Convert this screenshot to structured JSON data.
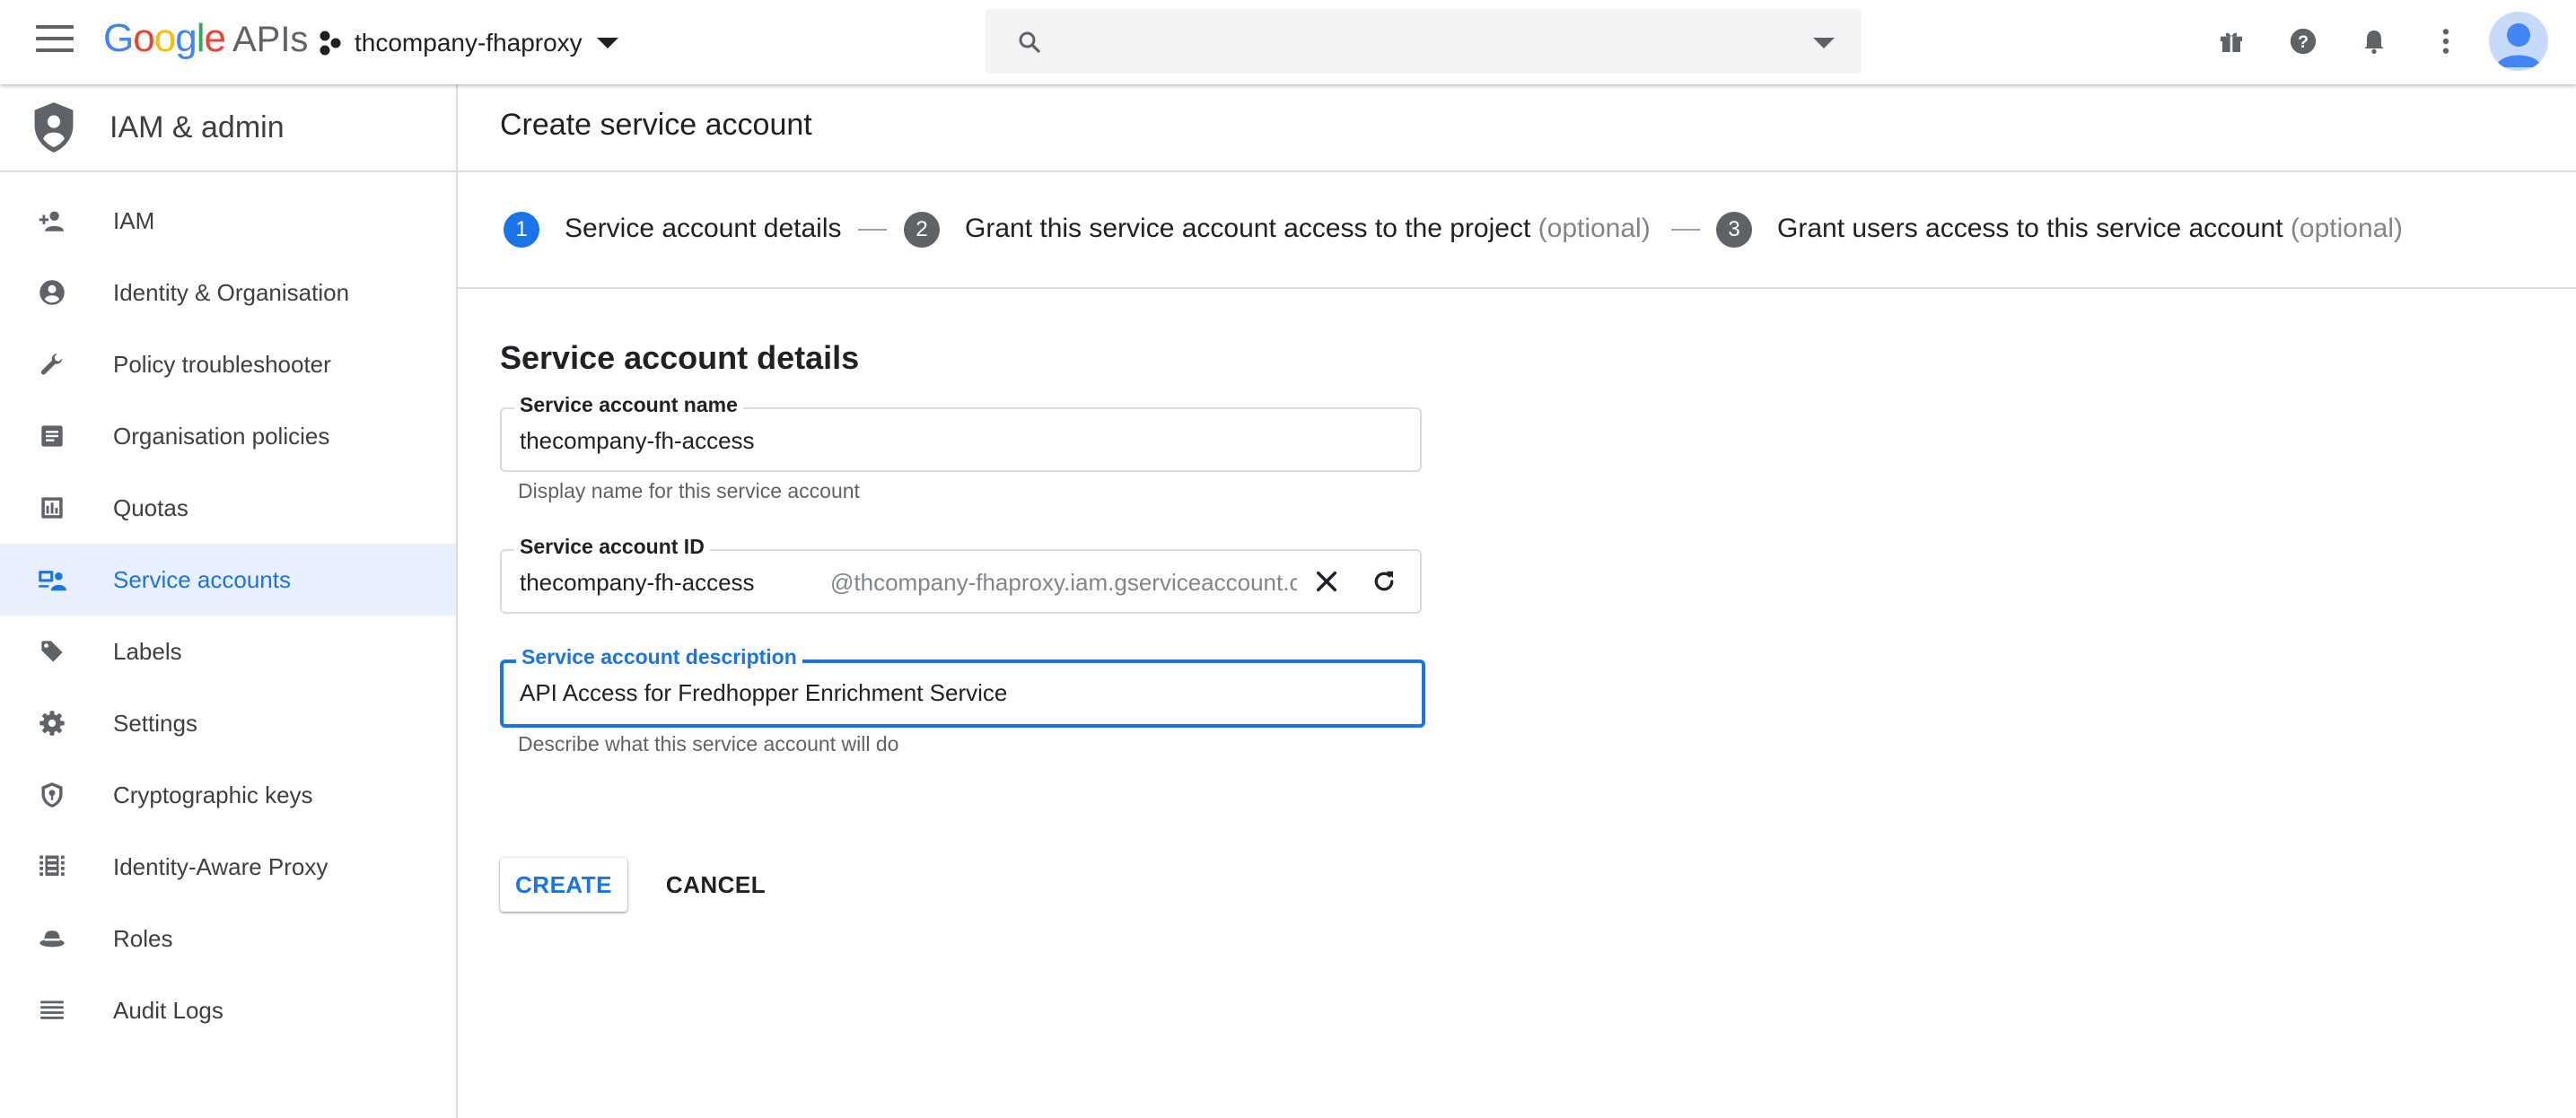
{
  "header": {
    "logo_letters": [
      "G",
      "o",
      "o",
      "g",
      "l",
      "e"
    ],
    "logo_suffix": "APIs",
    "project_name": "thcompany-fhaproxy",
    "search": {
      "value": "",
      "placeholder": ""
    },
    "icons": [
      "menu-icon",
      "project-icon",
      "search-icon",
      "gift-icon",
      "help-icon",
      "notifications-icon",
      "more-vert-icon",
      "account-avatar"
    ],
    "colors": {
      "google_blue": "#4285f4",
      "google_red": "#ea4335",
      "google_yellow": "#fbbc05",
      "google_green": "#34a853"
    }
  },
  "sidebar": {
    "title": "IAM & admin",
    "items": [
      {
        "label": "IAM",
        "icon": "person-add-icon",
        "active": false
      },
      {
        "label": "Identity & Organisation",
        "icon": "account-circle-icon",
        "active": false
      },
      {
        "label": "Policy troubleshooter",
        "icon": "wrench-icon",
        "active": false
      },
      {
        "label": "Organisation policies",
        "icon": "document-icon",
        "active": false
      },
      {
        "label": "Quotas",
        "icon": "quota-icon",
        "active": false
      },
      {
        "label": "Service accounts",
        "icon": "service-account-icon",
        "active": true
      },
      {
        "label": "Labels",
        "icon": "tag-icon",
        "active": false
      },
      {
        "label": "Settings",
        "icon": "gear-icon",
        "active": false
      },
      {
        "label": "Cryptographic keys",
        "icon": "key-shield-icon",
        "active": false
      },
      {
        "label": "Identity-Aware Proxy",
        "icon": "proxy-icon",
        "active": false
      },
      {
        "label": "Roles",
        "icon": "hat-icon",
        "active": false
      },
      {
        "label": "Audit Logs",
        "icon": "list-icon",
        "active": false
      }
    ]
  },
  "main": {
    "page_title": "Create service account",
    "steps": [
      {
        "number": "1",
        "label": "Service account details",
        "optional": "",
        "active": true
      },
      {
        "number": "2",
        "label": "Grant this service account access to the project",
        "optional": "(optional)",
        "active": false
      },
      {
        "number": "3",
        "label": "Grant users access to this service account",
        "optional": "(optional)",
        "active": false
      }
    ],
    "section_title": "Service account details",
    "fields": {
      "name": {
        "label": "Service account name",
        "value": "thecompany-fh-access",
        "hint": "Display name for this service account"
      },
      "id": {
        "label": "Service account ID",
        "value": "thecompany-fh-access",
        "suffix": "@thcompany-fhaproxy.iam.gserviceaccount.com"
      },
      "description": {
        "label": "Service account description",
        "value": "API Access for Fredhopper Enrichment Service",
        "hint": "Describe what this service account will do"
      }
    },
    "buttons": {
      "create": "CREATE",
      "cancel": "CANCEL"
    },
    "colors": {
      "accent": "#1a73e8",
      "active_step": "#1a73e8",
      "inactive_step": "#5f6368",
      "active_nav_bg": "#e8f0fe"
    }
  }
}
